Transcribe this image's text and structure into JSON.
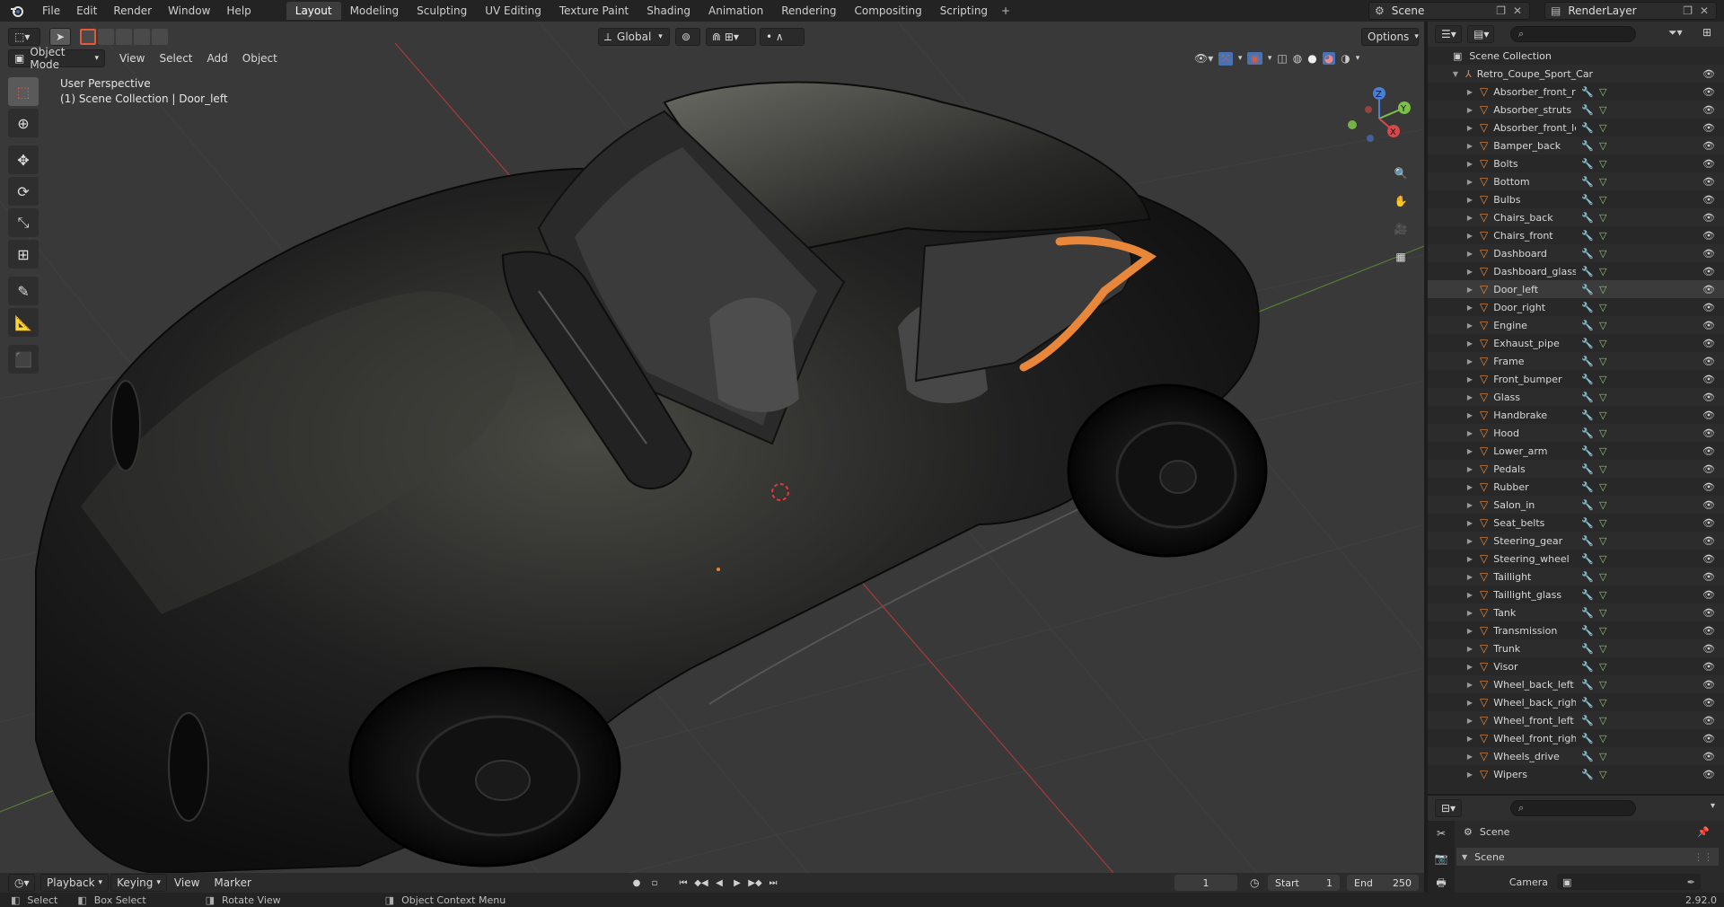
{
  "topbar": {
    "menus": [
      "File",
      "Edit",
      "Render",
      "Window",
      "Help"
    ],
    "tabs": [
      "Layout",
      "Modeling",
      "Sculpting",
      "UV Editing",
      "Texture Paint",
      "Shading",
      "Animation",
      "Rendering",
      "Compositing",
      "Scripting"
    ],
    "active_tab": "Layout",
    "add_tab": "+",
    "scene": "Scene",
    "view_layer": "RenderLayer"
  },
  "viewport": {
    "mode": "Object Mode",
    "menus": [
      "View",
      "Select",
      "Add",
      "Object"
    ],
    "transform_orientation": "Global",
    "options_label": "Options",
    "perspective_label": "User Perspective",
    "collection_label": "(1) Scene Collection | Door_left",
    "axis_labels": {
      "x": "X",
      "y": "Y",
      "z": "Z"
    }
  },
  "toolbar": {
    "tools": [
      "select-box-icon",
      "cursor-icon",
      "move-icon",
      "rotate-icon",
      "scale-icon",
      "transform-icon",
      "annotate-icon",
      "measure-icon",
      "add-cube-icon"
    ]
  },
  "outliner": {
    "root": "Scene Collection",
    "collection": "Retro_Coupe_Sport_Car",
    "selected": "Door_left",
    "items": [
      "Absorber_front_right",
      "Absorber_struts",
      "Absorber_front_left",
      "Bamper_back",
      "Bolts",
      "Bottom",
      "Bulbs",
      "Chairs_back",
      "Chairs_front",
      "Dashboard",
      "Dashboard_glass",
      "Door_left",
      "Door_right",
      "Engine",
      "Exhaust_pipe",
      "Frame",
      "Front_bumper",
      "Glass",
      "Handbrake",
      "Hood",
      "Lower_arm",
      "Pedals",
      "Rubber",
      "Salon_in",
      "Seat_belts",
      "Steering_gear",
      "Steering_wheel",
      "Taillight",
      "Taillight_glass",
      "Tank",
      "Transmission",
      "Trunk",
      "Visor",
      "Wheel_back_left",
      "Wheel_back_right",
      "Wheel_front_left",
      "Wheel_front_right",
      "Wheels_drive",
      "Wipers"
    ]
  },
  "properties": {
    "breadcrumb": "Scene",
    "panel": "Scene",
    "camera_label": "Camera"
  },
  "timeline": {
    "menus": [
      "Playback",
      "Keying",
      "View",
      "Marker"
    ],
    "current_frame": "1",
    "start_label": "Start",
    "start": "1",
    "end_label": "End",
    "end": "250"
  },
  "statusbar": {
    "select": "Select",
    "box_select": "Box Select",
    "rotate_view": "Rotate View",
    "context_menu": "Object Context Menu",
    "version": "2.92.0"
  },
  "colors": {
    "accent_blue": "#4772b3",
    "mesh_orange": "#e8873a",
    "modifier_blue": "#6e9fe0",
    "data_green": "#8fc76b",
    "grid_red": "#a83a3a",
    "grid_green": "#5f8f2f"
  }
}
